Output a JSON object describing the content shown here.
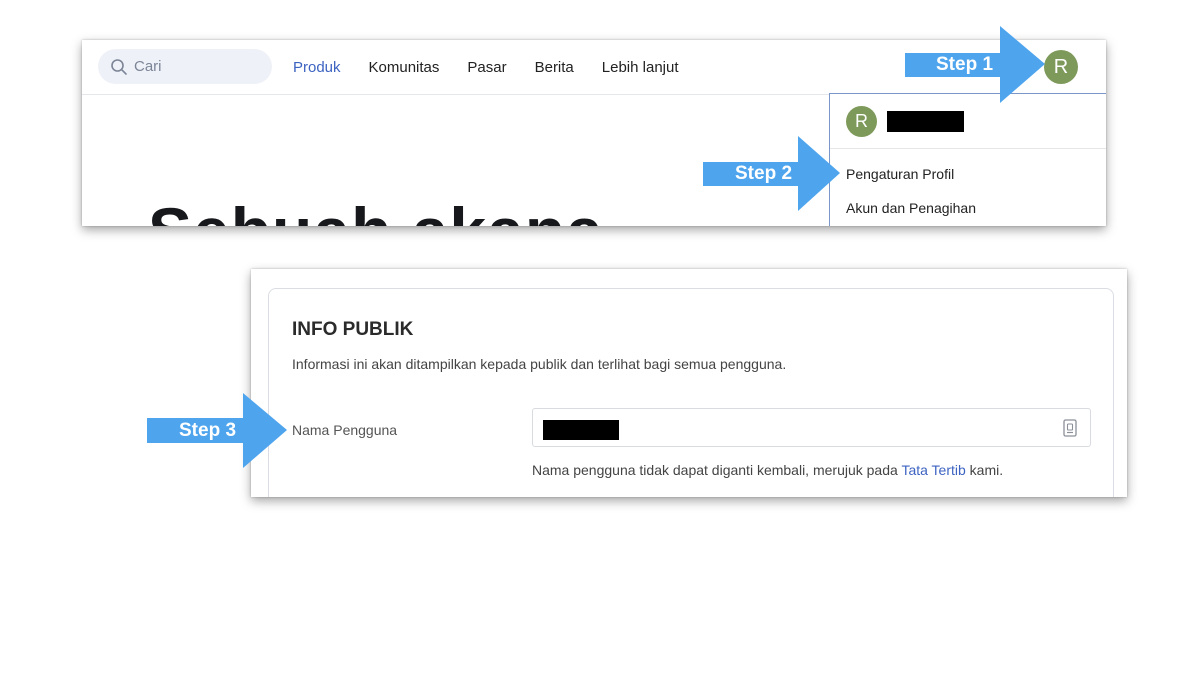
{
  "nav": {
    "search_placeholder": "Cari",
    "items": [
      {
        "label": "Produk",
        "active": true
      },
      {
        "label": "Komunitas",
        "active": false
      },
      {
        "label": "Pasar",
        "active": false
      },
      {
        "label": "Berita",
        "active": false
      },
      {
        "label": "Lebih lanjut",
        "active": false
      }
    ],
    "avatar_initial": "R"
  },
  "hero": {
    "text": "Sebuah akana"
  },
  "dropdown": {
    "avatar_initial": "R",
    "items": [
      "Pengaturan Profil",
      "Akun dan Penagihan"
    ]
  },
  "settings": {
    "title": "INFO PUBLIK",
    "description": "Informasi ini akan ditampilkan kepada publik dan terlihat bagi semua pengguna.",
    "field_label": "Nama Pengguna",
    "help_prefix": "Nama pengguna tidak dapat diganti kembali, merujuk pada",
    "help_link": "Tata Tertib",
    "help_suffix": "kami."
  },
  "steps": [
    "Step 1",
    "Step 2",
    "Step 3"
  ],
  "colors": {
    "arrow": "#4ea5ee",
    "accent": "#3d63c2",
    "avatar": "#7d9a5a"
  }
}
